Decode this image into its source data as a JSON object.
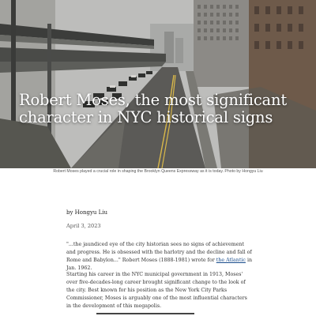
{
  "hero": {
    "title": "Robert Moses, the most significant character in NYC historical signs",
    "caption": "Robert Moses played a crucial role in shaping the Brooklyn Queens Expressway as it is today. Photo by Hongyu Liu"
  },
  "article": {
    "byline": "by Hongyu Liu",
    "date": "April 3, 2023",
    "para1_text": "\"...the jaundiced eye of the city historian sees no signs of achievement and progress. He is obsessed with the harlotry and the decline and fall of Rome and Babylon...\" Robert Moses (1888-1981) wrote for ",
    "para1_link": "the Atlantic",
    "para1_end": " in Jan. 1962.",
    "para2": "Starting his career in the NYC municipal government in 1913, Moses' over five-decades-long career brought significant change to the look of the city. Best known for his position as the New York City Parks Commissioner, Moses is arguably one of the most influential characters in the development of this megapolis."
  }
}
